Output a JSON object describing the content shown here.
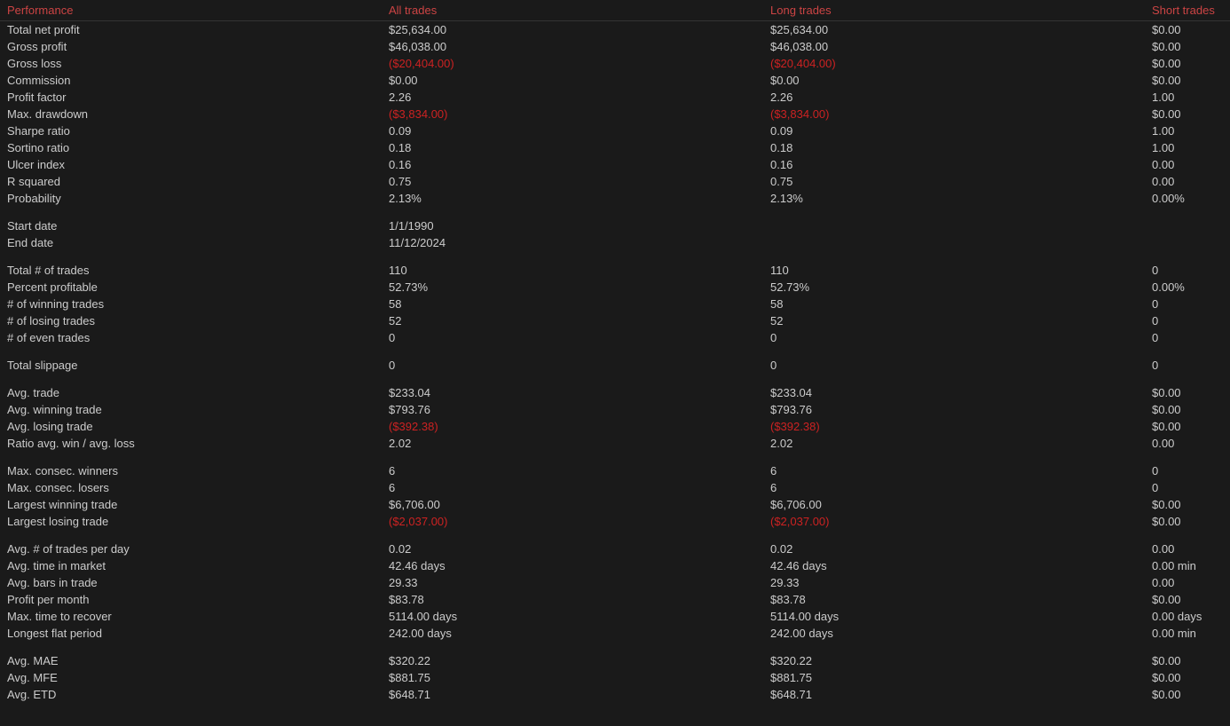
{
  "header": {
    "col1": "Performance",
    "col2": "All trades",
    "col3": "Long trades",
    "col4": "Short trades"
  },
  "rows": [
    {
      "label": "Total net profit",
      "all": "$25,634.00",
      "long": "$25,634.00",
      "short": "$0.00",
      "all_red": false,
      "long_red": false
    },
    {
      "label": "Gross profit",
      "all": "$46,038.00",
      "long": "$46,038.00",
      "short": "$0.00",
      "all_red": false,
      "long_red": false
    },
    {
      "label": "Gross loss",
      "all": "($20,404.00)",
      "long": "($20,404.00)",
      "short": "$0.00",
      "all_red": true,
      "long_red": true
    },
    {
      "label": "Commission",
      "all": "$0.00",
      "long": "$0.00",
      "short": "$0.00",
      "all_red": false,
      "long_red": false
    },
    {
      "label": "Profit factor",
      "all": "2.26",
      "long": "2.26",
      "short": "1.00",
      "all_red": false,
      "long_red": false
    },
    {
      "label": "Max. drawdown",
      "all": "($3,834.00)",
      "long": "($3,834.00)",
      "short": "$0.00",
      "all_red": true,
      "long_red": true
    },
    {
      "label": "Sharpe ratio",
      "all": "0.09",
      "long": "0.09",
      "short": "1.00",
      "all_red": false,
      "long_red": false
    },
    {
      "label": "Sortino ratio",
      "all": "0.18",
      "long": "0.18",
      "short": "1.00",
      "all_red": false,
      "long_red": false
    },
    {
      "label": "Ulcer index",
      "all": "0.16",
      "long": "0.16",
      "short": "0.00",
      "all_red": false,
      "long_red": false
    },
    {
      "label": "R squared",
      "all": "0.75",
      "long": "0.75",
      "short": "0.00",
      "all_red": false,
      "long_red": false
    },
    {
      "label": "Probability",
      "all": "2.13%",
      "long": "2.13%",
      "short": "0.00%",
      "all_red": false,
      "long_red": false
    },
    {
      "spacer": true
    },
    {
      "label": "Start date",
      "all": "1/1/1990",
      "long": "",
      "short": "",
      "all_red": false,
      "long_red": false
    },
    {
      "label": "End date",
      "all": "11/12/2024",
      "long": "",
      "short": "",
      "all_red": false,
      "long_red": false
    },
    {
      "spacer": true
    },
    {
      "label": "Total # of trades",
      "all": "110",
      "long": "110",
      "short": "0",
      "all_red": false,
      "long_red": false
    },
    {
      "label": "Percent profitable",
      "all": "52.73%",
      "long": "52.73%",
      "short": "0.00%",
      "all_red": false,
      "long_red": false
    },
    {
      "label": "# of winning trades",
      "all": "58",
      "long": "58",
      "short": "0",
      "all_red": false,
      "long_red": false
    },
    {
      "label": "# of losing trades",
      "all": "52",
      "long": "52",
      "short": "0",
      "all_red": false,
      "long_red": false
    },
    {
      "label": "# of even trades",
      "all": "0",
      "long": "0",
      "short": "0",
      "all_red": false,
      "long_red": false
    },
    {
      "spacer": true
    },
    {
      "label": "Total slippage",
      "all": "0",
      "long": "0",
      "short": "0",
      "all_red": false,
      "long_red": false
    },
    {
      "spacer": true
    },
    {
      "label": "Avg. trade",
      "all": "$233.04",
      "long": "$233.04",
      "short": "$0.00",
      "all_red": false,
      "long_red": false
    },
    {
      "label": "Avg. winning trade",
      "all": "$793.76",
      "long": "$793.76",
      "short": "$0.00",
      "all_red": false,
      "long_red": false
    },
    {
      "label": "Avg. losing trade",
      "all": "($392.38)",
      "long": "($392.38)",
      "short": "$0.00",
      "all_red": true,
      "long_red": true
    },
    {
      "label": "Ratio avg. win / avg. loss",
      "all": "2.02",
      "long": "2.02",
      "short": "0.00",
      "all_red": false,
      "long_red": false
    },
    {
      "spacer": true
    },
    {
      "label": "Max. consec. winners",
      "all": "6",
      "long": "6",
      "short": "0",
      "all_red": false,
      "long_red": false
    },
    {
      "label": "Max. consec. losers",
      "all": "6",
      "long": "6",
      "short": "0",
      "all_red": false,
      "long_red": false
    },
    {
      "label": "Largest winning trade",
      "all": "$6,706.00",
      "long": "$6,706.00",
      "short": "$0.00",
      "all_red": false,
      "long_red": false
    },
    {
      "label": "Largest losing trade",
      "all": "($2,037.00)",
      "long": "($2,037.00)",
      "short": "$0.00",
      "all_red": true,
      "long_red": true
    },
    {
      "spacer": true
    },
    {
      "label": "Avg. # of trades per day",
      "all": "0.02",
      "long": "0.02",
      "short": "0.00",
      "all_red": false,
      "long_red": false
    },
    {
      "label": "Avg. time in market",
      "all": "42.46 days",
      "long": "42.46 days",
      "short": "0.00 min",
      "all_red": false,
      "long_red": false
    },
    {
      "label": "Avg. bars in trade",
      "all": "29.33",
      "long": "29.33",
      "short": "0.00",
      "all_red": false,
      "long_red": false
    },
    {
      "label": "Profit per month",
      "all": "$83.78",
      "long": "$83.78",
      "short": "$0.00",
      "all_red": false,
      "long_red": false
    },
    {
      "label": "Max. time to recover",
      "all": "5114.00 days",
      "long": "5114.00 days",
      "short": "0.00 days",
      "all_red": false,
      "long_red": false
    },
    {
      "label": "Longest flat period",
      "all": "242.00 days",
      "long": "242.00 days",
      "short": "0.00 min",
      "all_red": false,
      "long_red": false
    },
    {
      "spacer": true
    },
    {
      "label": "Avg. MAE",
      "all": "$320.22",
      "long": "$320.22",
      "short": "$0.00",
      "all_red": false,
      "long_red": false
    },
    {
      "label": "Avg. MFE",
      "all": "$881.75",
      "long": "$881.75",
      "short": "$0.00",
      "all_red": false,
      "long_red": false
    },
    {
      "label": "Avg. ETD",
      "all": "$648.71",
      "long": "$648.71",
      "short": "$0.00",
      "all_red": false,
      "long_red": false
    }
  ]
}
